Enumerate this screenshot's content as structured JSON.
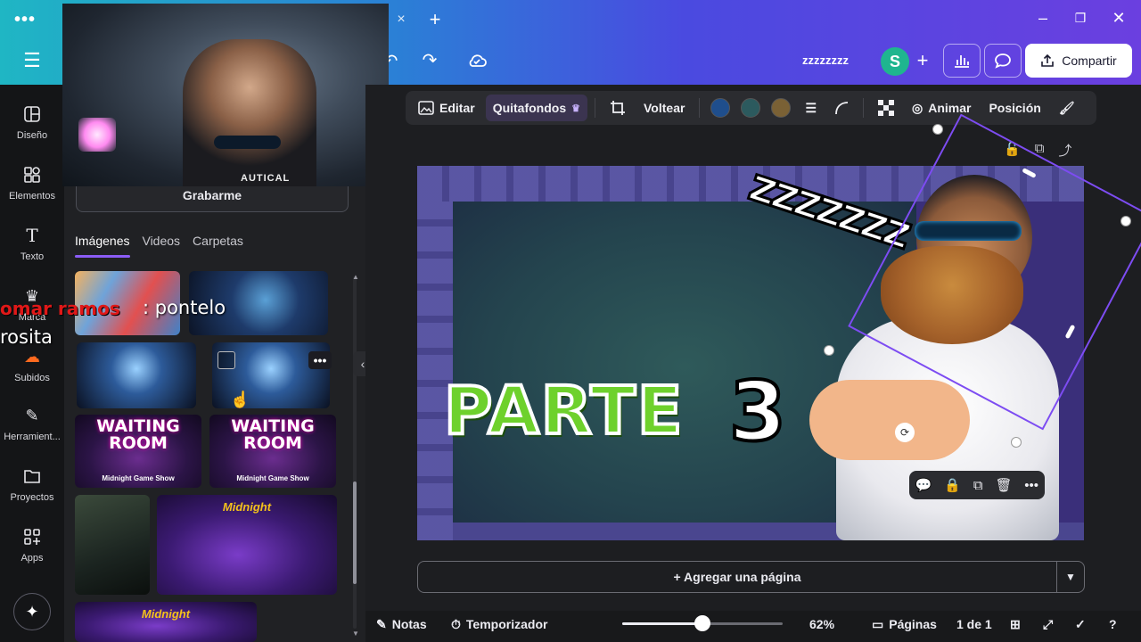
{
  "window": {
    "menu_icon": "more-dots-icon",
    "tab_close": "×",
    "new_tab": "+",
    "minimize": "–",
    "maximize": "❐",
    "close": "✕"
  },
  "header": {
    "doc_name": "zzzzzzzz",
    "avatar_letter": "S",
    "share_label": "Compartir"
  },
  "rail": {
    "items": [
      {
        "label": "Diseño",
        "icon": "layout-icon"
      },
      {
        "label": "Elementos",
        "icon": "shapes-icon"
      },
      {
        "label": "Texto",
        "icon": "text-icon"
      },
      {
        "label": "Marca",
        "icon": "brand-icon"
      },
      {
        "label": "Subidos",
        "icon": "upload-icon"
      },
      {
        "label": "Herramient...",
        "icon": "tools-icon"
      },
      {
        "label": "Proyectos",
        "icon": "folder-icon"
      },
      {
        "label": "Apps",
        "icon": "apps-icon"
      }
    ]
  },
  "panel": {
    "record_label": "Grabarme",
    "tabs": [
      "Imágenes",
      "Videos",
      "Carpetas"
    ],
    "active_tab": 0,
    "waiting_title": "WAITING ROOM",
    "waiting_subtitle": "Midnight Game Show",
    "show_title": "Midnight"
  },
  "webcam": {
    "shirt_text": "AUTICAL"
  },
  "chat": {
    "user": "omar ramos",
    "message": ": pontelo",
    "user2": "rosita"
  },
  "toolbar": {
    "edit": "Editar",
    "bg_remover": "Quitafondos",
    "flip": "Voltear",
    "animate": "Animar",
    "position": "Posición",
    "colors": [
      "#1f4e8c",
      "#2c5a5e",
      "#7a6135"
    ]
  },
  "canvas": {
    "title_word": "PARTE",
    "title_number": "3",
    "sleep_text": "zzzzzzz"
  },
  "add_page_label": "+ Agregar una página",
  "bottom": {
    "notes": "Notas",
    "timer": "Temporizador",
    "zoom": "62%",
    "zoom_fraction": 0.5,
    "pages": "Páginas",
    "page_count": "1 de 1"
  }
}
